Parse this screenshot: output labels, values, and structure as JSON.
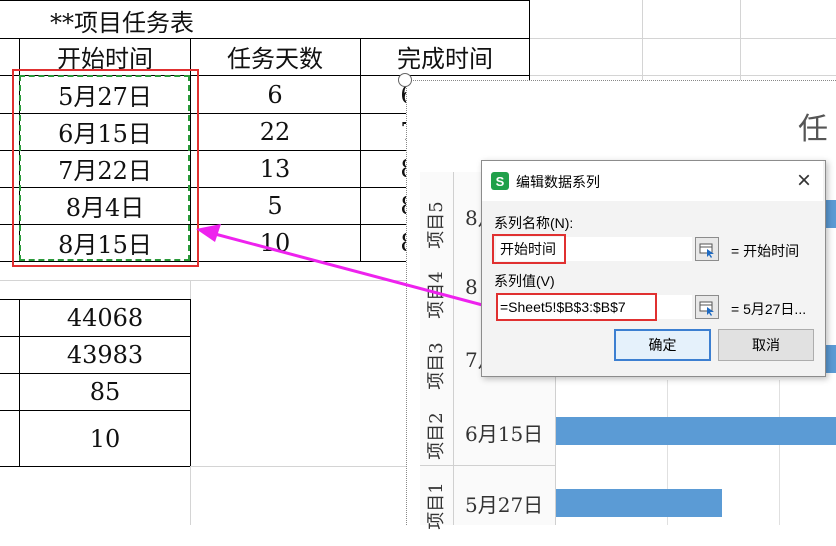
{
  "sheet": {
    "title": "**项目任务表",
    "headers": [
      "开始时间",
      "任务天数",
      "完成时间"
    ],
    "start_dates": [
      "5月27日",
      "6月15日",
      "7月22日",
      "8月4日",
      "8月15日"
    ],
    "task_days": [
      "6",
      "22",
      "13",
      "5",
      "10"
    ],
    "finish_partial": [
      "6",
      "7",
      "8",
      "8",
      "8"
    ],
    "summary_values": [
      "44068",
      "43983",
      "85",
      "10"
    ]
  },
  "chart": {
    "title_partial": "任",
    "categories": [
      "项目5",
      "项目4",
      "项目3",
      "项目2",
      "项目1"
    ],
    "date_labels": [
      "8月",
      "8",
      "7月",
      "6月15日",
      "5月27日"
    ],
    "bar_color": "#5b9bd5",
    "visible_bar_fill": {
      "项目5": 1.0,
      "项目3": 1.0,
      "项目2": 1.0,
      "项目1": 0.59
    }
  },
  "dialog": {
    "title": "编辑数据系列",
    "app_icon": "S",
    "close_icon": "×",
    "series_name_label": "系列名称(N):",
    "series_name_value": "开始时间",
    "series_name_result": "= 开始时间",
    "series_values_label": "系列值(V)",
    "series_values_value": "=Sheet5!$B$3:$B$7",
    "series_values_result": "= 5月27日...",
    "ok_label": "确定",
    "cancel_label": "取消"
  },
  "colors": {
    "highlight_red": "#e03030",
    "arrow_magenta": "#ee22ee",
    "selection_green": "#2a9a3a",
    "wps_green": "#20a04a"
  }
}
